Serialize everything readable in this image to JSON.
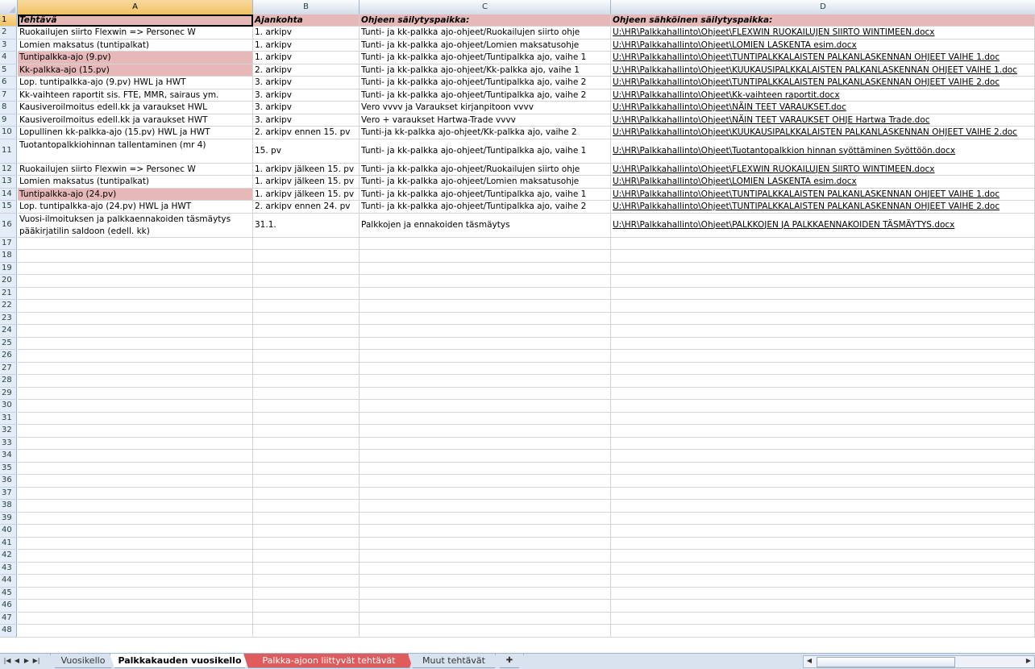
{
  "columns": [
    "A",
    "B",
    "C",
    "D"
  ],
  "header": [
    "Tehtävä",
    "Ajankohta",
    "Ohjeen säilytyspaikka:",
    "Ohjeen sähköinen säilytyspaikka:"
  ],
  "rows": [
    {
      "a": "Ruokailujen siirto Flexwin => Personec W",
      "b": "1. arkipv",
      "c": "Tunti- ja kk-palkka ajo-ohjeet/Ruokailujen siirto ohje",
      "d": "U:\\HR\\Palkkahallinto\\Ohjeet\\FLEXWIN RUOKAILUJEN SIIRTO WINTIMEEN.docx"
    },
    {
      "a": "Lomien maksatus (tuntipalkat)",
      "b": "1. arkipv",
      "c": "Tunti- ja kk-palkka ajo-ohjeet/Lomien maksatusohje",
      "d": "U:\\HR\\Palkkahallinto\\Ohjeet\\LOMIEN LASKENTA esim.docx"
    },
    {
      "a": "Tuntipalkka-ajo (9.pv)",
      "b": "1. arkipv",
      "c": "Tunti- ja kk-palkka ajo-ohjeet/Tuntipalkka ajo, vaihe 1",
      "d": "U:\\HR\\Palkkahallinto\\Ohjeet\\TUNTIPALKKALAISTEN PALKANLASKENNAN OHJEET VAIHE 1.doc"
    },
    {
      "a": "Kk-palkka-ajo (15.pv)",
      "b": "2. arkipv",
      "c": "Tunti- ja kk-palkka ajo-ohjeet/Kk-palkka ajo, vaihe 1",
      "d": "U:\\HR\\Palkkahallinto\\Ohjeet\\KUUKAUSIPALKKALAISTEN PALKANLASKENNAN OHJEET VAIHE 1.doc"
    },
    {
      "a": "Lop. tuntipalkka-ajo (9.pv) HWL ja HWT",
      "b": "3. arkipv",
      "c": "Tunti- ja kk-palkka ajo-ohjeet/Tuntipalkka ajo, vaihe 2",
      "d": "U:\\HR\\Palkkahallinto\\Ohjeet\\TUNTIPALKKALAISTEN PALKANLASKENNAN OHJEET VAIHE 2.doc"
    },
    {
      "a": "Kk-vaihteen raportit sis. FTE, MMR, sairaus ym.",
      "b": "3. arkipv",
      "c": "Tunti- ja kk-palkka ajo-ohjeet/Tuntipalkka ajo, vaihe 2",
      "d": "U:\\HR\\Palkkahallinto\\Ohjeet\\Kk-vaihteen raportit.docx"
    },
    {
      "a": "Kausiveroilmoitus edell.kk ja varaukset HWL",
      "b": "3. arkipv",
      "c": "Vero vvvv ja Varaukset kirjanpitoon vvvv",
      "d": "U:\\HR\\Palkkahallinto\\Ohjeet\\NÄIN TEET VARAUKSET.doc"
    },
    {
      "a": "Kausiveroilmoitus edell.kk ja varaukset HWT",
      "b": "3. arkipv",
      "c": "Vero + varaukset Hartwa-Trade vvvv",
      "d": "U:\\HR\\Palkkahallinto\\Ohjeet\\NÄIN TEET VARAUKSET OHJE Hartwa Trade.doc"
    },
    {
      "a": "Lopullinen kk-palkka-ajo (15.pv) HWL ja HWT",
      "b": "2. arkipv ennen 15. pv",
      "c": "Tunti-ja kk-palkka ajo-ohjeet/Kk-palkka ajo, vaihe 2",
      "d": "U:\\HR\\Palkkahallinto\\Ohjeet\\KUUKAUSIPALKKALAISTEN PALKANLASKENNAN OHJEET VAIHE 2.doc"
    },
    {
      "a": "Tuotantopalkkiohinnan tallentaminen (mr 4)",
      "b": "15. pv",
      "c": "Tunti- ja kk-palkka ajo-ohjeet/Tuntipalkka ajo, vaihe 1",
      "d": "U:\\HR\\Palkkahallinto\\Ohjeet\\Tuotantopalkkion hinnan syöttäminen Syöttöön.docx"
    },
    {
      "a": "Ruokailujen siirto Flexwin => Personec W",
      "b": "1. arkipv jälkeen 15. pv",
      "c": "Tunti- ja kk-palkka ajo-ohjeet/Ruokailujen siirto ohje",
      "d": "U:\\HR\\Palkkahallinto\\Ohjeet\\FLEXWIN RUOKAILUJEN SIIRTO WINTIMEEN.docx"
    },
    {
      "a": "Lomien maksatus (tuntipalkat)",
      "b": "1. arkipv jälkeen 15. pv",
      "c": "Tunti- ja kk-palkka ajo-ohjeet/Lomien maksatusohje",
      "d": "U:\\HR\\Palkkahallinto\\Ohjeet\\LOMIEN LASKENTA esim.docx"
    },
    {
      "a": "Tuntipalkka-ajo (24.pv)",
      "b": "1. arkipv jälkeen 15. pv",
      "c": "Tunti- ja kk-palkka ajo-ohjeet/Tuntipalkka ajo, vaihe 1",
      "d": "U:\\HR\\Palkkahallinto\\Ohjeet\\TUNTIPALKKALAISTEN PALKANLASKENNAN OHJEET VAIHE 1.doc"
    },
    {
      "a": "Lop. tuntipalkka-ajo (24.pv) HWL ja HWT",
      "b": "2. arkipv ennen 24. pv",
      "c": "Tunti- ja kk-palkka ajo-ohjeet/Tuntipalkka ajo, vaihe 2",
      "d": "U:\\HR\\Palkkahallinto\\Ohjeet\\TUNTIPALKKALAISTEN PALKANLASKENNAN OHJEET VAIHE 2.doc"
    },
    {
      "a": "Vuosi-ilmoituksen ja palkkaennakoiden täsmäytys pääkirjatilin saldoon (edell. kk)",
      "b": "31.1.",
      "c": "Palkkojen ja ennakoiden täsmäytys",
      "d": "U:\\HR\\Palkkahallinto\\Ohjeet\\PALKKOJEN JA PALKKAENNAKOIDEN TÄSMÄYTYS.docx"
    }
  ],
  "pink_rows": [
    4,
    5,
    14
  ],
  "empty_row_numbers": [
    17,
    18,
    19,
    20,
    21,
    22,
    23,
    24,
    25,
    26,
    27,
    28,
    29,
    30,
    31,
    32,
    33,
    34,
    35,
    36,
    37,
    38,
    39,
    40,
    41,
    42,
    43,
    44,
    45,
    46,
    47,
    48
  ],
  "tabs": [
    {
      "label": "Vuosikello",
      "state": "normal"
    },
    {
      "label": "Palkkakauden vuosikello",
      "state": "active"
    },
    {
      "label": "Palkka-ajoon liittyvät tehtävät",
      "state": "red"
    },
    {
      "label": "Muut tehtävät",
      "state": "normal"
    }
  ],
  "colors": {
    "header_fill": "#e6b9b8",
    "grid": "#d4d4d4",
    "active_tab": "#ffffff",
    "red_tab": "#e05c5c"
  }
}
